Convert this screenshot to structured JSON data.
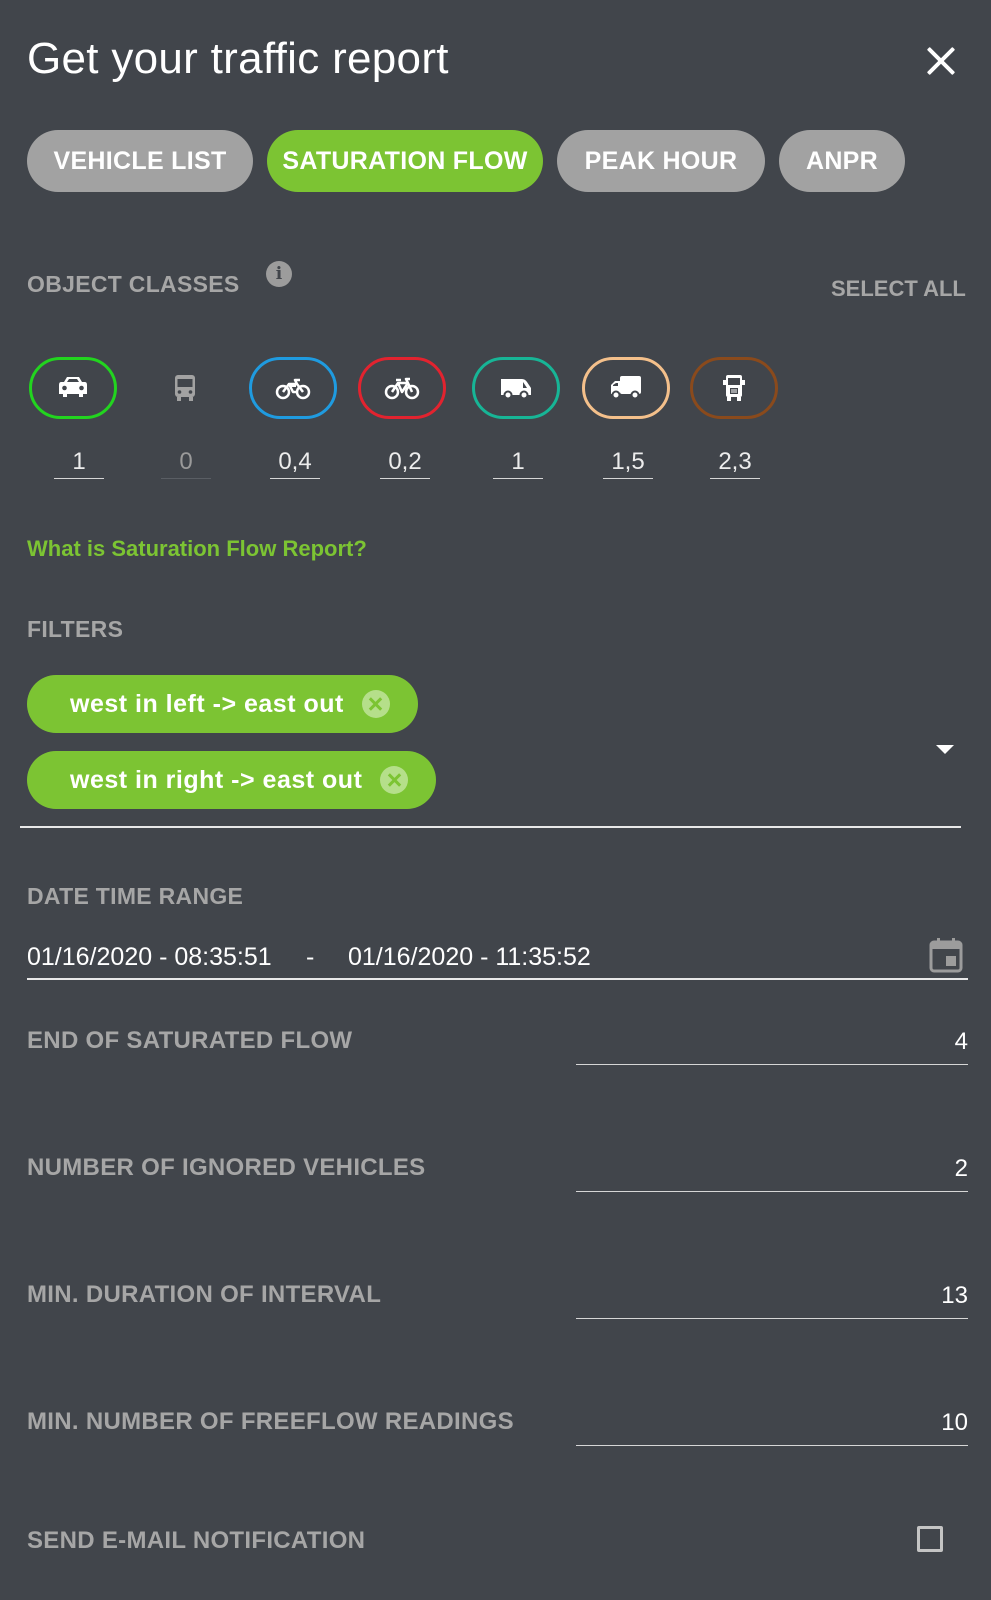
{
  "dialog": {
    "title": "Get your traffic report",
    "close_icon": "close-icon"
  },
  "tabs": [
    {
      "label": "VEHICLE LIST",
      "active": false
    },
    {
      "label": "SATURATION FLOW",
      "active": true
    },
    {
      "label": "PEAK HOUR",
      "active": false
    },
    {
      "label": "ANPR",
      "active": false
    }
  ],
  "object_classes": {
    "label": "OBJECT CLASSES",
    "info_icon": "i",
    "select_all": "SELECT ALL",
    "items": [
      {
        "icon": "car-icon",
        "value": "1",
        "border_color": "#22d41f",
        "selected": true
      },
      {
        "icon": "bus-icon",
        "value": "0",
        "border_color": "",
        "selected": false
      },
      {
        "icon": "motorcycle-icon",
        "value": "0,4",
        "border_color": "#1f9be0",
        "selected": true
      },
      {
        "icon": "bicycle-icon",
        "value": "0,2",
        "border_color": "#e2232f",
        "selected": true
      },
      {
        "icon": "van-icon",
        "value": "1",
        "border_color": "#17b596",
        "selected": true
      },
      {
        "icon": "truck-icon",
        "value": "1,5",
        "border_color": "#f4c08b",
        "selected": true
      },
      {
        "icon": "heavy-truck-icon",
        "value": "2,3",
        "border_color": "#8a4a1c",
        "selected": true
      }
    ]
  },
  "help_link": "What is Saturation Flow Report?",
  "filters": {
    "label": "FILTERS",
    "chips": [
      {
        "label": "west in left -> east out"
      },
      {
        "label": "west in right -> east out"
      }
    ]
  },
  "date_range": {
    "label": "DATE TIME RANGE",
    "start": "01/16/2020 - 08:35:51",
    "separator": "-",
    "end": "01/16/2020 - 11:35:52"
  },
  "fields": [
    {
      "label": "END OF SATURATED FLOW",
      "value": "4"
    },
    {
      "label": "NUMBER OF IGNORED VEHICLES",
      "value": "2"
    },
    {
      "label": "MIN. DURATION OF INTERVAL",
      "value": "13"
    },
    {
      "label": "MIN. NUMBER OF FREEFLOW READINGS",
      "value": "10"
    }
  ],
  "notification": {
    "label": "SEND E-MAIL NOTIFICATION",
    "checked": false
  },
  "colors": {
    "background": "#41454b",
    "accent": "#7cc433",
    "inactive_tab": "#a2a2a2",
    "label": "#a6a6a6"
  }
}
